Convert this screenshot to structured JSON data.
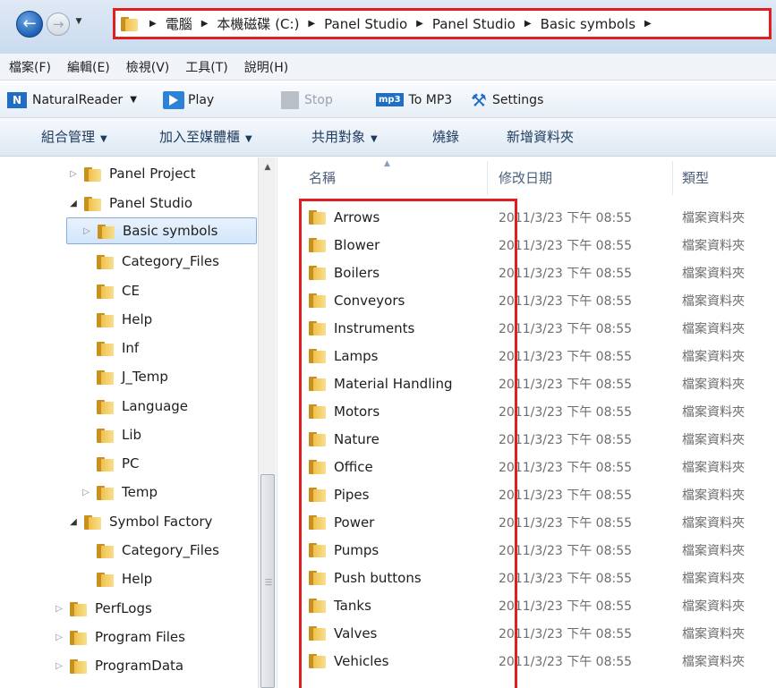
{
  "address_bar": {
    "breadcrumbs": [
      "電腦",
      "本機磁碟 (C:)",
      "Panel Studio",
      "Panel Studio",
      "Basic symbols"
    ]
  },
  "menu": {
    "items": [
      "檔案(F)",
      "編輯(E)",
      "檢視(V)",
      "工具(T)",
      "說明(H)"
    ]
  },
  "reader_toolbar": {
    "naturalreader": "NaturalReader",
    "play": "Play",
    "stop": "Stop",
    "mp3_badge": "mp3",
    "to_mp3": "To MP3",
    "settings": "Settings"
  },
  "command_bar": {
    "organize": "組合管理",
    "add_to_library": "加入至媒體櫃",
    "share_with": "共用對象",
    "burn": "燒錄",
    "new_folder": "新增資料夾"
  },
  "nav_tree": [
    {
      "label": "Panel Project",
      "expander": "▷"
    },
    {
      "label": "Panel Studio",
      "expander": "◢"
    },
    {
      "label": "Basic symbols",
      "expander": "▷",
      "selected": true
    },
    {
      "label": "Category_Files",
      "expander": ""
    },
    {
      "label": "CE",
      "expander": ""
    },
    {
      "label": "Help",
      "expander": ""
    },
    {
      "label": "Inf",
      "expander": ""
    },
    {
      "label": "J_Temp",
      "expander": ""
    },
    {
      "label": "Language",
      "expander": ""
    },
    {
      "label": "Lib",
      "expander": ""
    },
    {
      "label": "PC",
      "expander": ""
    },
    {
      "label": "Temp",
      "expander": "▷"
    },
    {
      "label": "Symbol Factory",
      "expander": "◢"
    },
    {
      "label": "Category_Files",
      "expander": ""
    },
    {
      "label": "Help",
      "expander": ""
    },
    {
      "label": "PerfLogs",
      "expander": "▷"
    },
    {
      "label": "Program Files",
      "expander": "▷"
    },
    {
      "label": "ProgramData",
      "expander": "▷"
    }
  ],
  "columns": {
    "name": "名稱",
    "date": "修改日期",
    "type": "類型"
  },
  "files": [
    {
      "name": "Arrows",
      "date": "2011/3/23 下午 08:55",
      "type": "檔案資料夾"
    },
    {
      "name": "Blower",
      "date": "2011/3/23 下午 08:55",
      "type": "檔案資料夾"
    },
    {
      "name": "Boilers",
      "date": "2011/3/23 下午 08:55",
      "type": "檔案資料夾"
    },
    {
      "name": "Conveyors",
      "date": "2011/3/23 下午 08:55",
      "type": "檔案資料夾"
    },
    {
      "name": "Instruments",
      "date": "2011/3/23 下午 08:55",
      "type": "檔案資料夾"
    },
    {
      "name": "Lamps",
      "date": "2011/3/23 下午 08:55",
      "type": "檔案資料夾"
    },
    {
      "name": "Material Handling",
      "date": "2011/3/23 下午 08:55",
      "type": "檔案資料夾"
    },
    {
      "name": "Motors",
      "date": "2011/3/23 下午 08:55",
      "type": "檔案資料夾"
    },
    {
      "name": "Nature",
      "date": "2011/3/23 下午 08:55",
      "type": "檔案資料夾"
    },
    {
      "name": "Office",
      "date": "2011/3/23 下午 08:55",
      "type": "檔案資料夾"
    },
    {
      "name": "Pipes",
      "date": "2011/3/23 下午 08:55",
      "type": "檔案資料夾"
    },
    {
      "name": "Power",
      "date": "2011/3/23 下午 08:55",
      "type": "檔案資料夾"
    },
    {
      "name": "Pumps",
      "date": "2011/3/23 下午 08:55",
      "type": "檔案資料夾"
    },
    {
      "name": "Push buttons",
      "date": "2011/3/23 下午 08:55",
      "type": "檔案資料夾"
    },
    {
      "name": "Tanks",
      "date": "2011/3/23 下午 08:55",
      "type": "檔案資料夾"
    },
    {
      "name": "Valves",
      "date": "2011/3/23 下午 08:55",
      "type": "檔案資料夾"
    },
    {
      "name": "Vehicles",
      "date": "2011/3/23 下午 08:55",
      "type": "檔案資料夾"
    }
  ],
  "colors": {
    "annotation_red": "#e02020",
    "folder_gold": "#f0c14a",
    "selection_blue": "#84acdd",
    "toolbar_blue": "#1f6ec4"
  },
  "icons": [
    "back-arrow-icon",
    "forward-arrow-icon",
    "folder-icon",
    "play-icon",
    "stop-icon",
    "mp3-icon",
    "settings-icon",
    "expander-icon"
  ]
}
